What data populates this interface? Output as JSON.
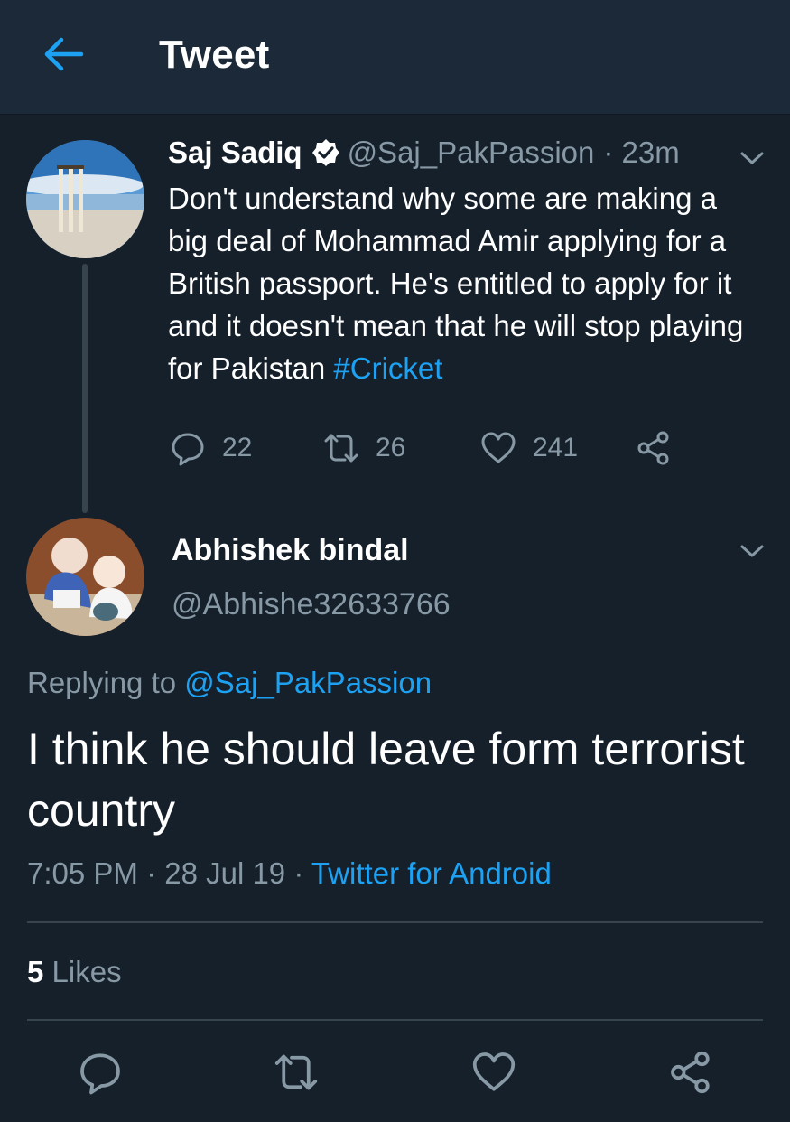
{
  "header": {
    "title": "Tweet"
  },
  "parent": {
    "name": "Saj Sadiq",
    "handle": "@Saj_PakPassion",
    "time": "· 23m",
    "text": "Don't understand why some are making a big deal of Mohammad Amir applying for a British passport. He's entitled to apply for it and it doesn't mean that he will stop playing for Pakistan ",
    "hashtag": "#Cricket",
    "replies": "22",
    "retweets": "26",
    "likes": "241"
  },
  "reply": {
    "name": "Abhishek bindal",
    "handle": "@Abhishe32633766",
    "replying_prefix": "Replying to ",
    "replying_to": "@Saj_PakPassion",
    "text": "I think he should leave form terrorist country",
    "time": "7:05 PM · 28 Jul 19 · ",
    "source": "Twitter for Android",
    "likes_count": "5",
    "likes_label": " Likes"
  },
  "colors": {
    "background": "#15202b",
    "header": "#1c2938",
    "accent": "#1da1f2",
    "muted": "#8899a6"
  },
  "icons": [
    "back-arrow-icon",
    "verified-icon",
    "chevron-down-icon",
    "reply-icon",
    "retweet-icon",
    "like-icon",
    "share-icon"
  ]
}
